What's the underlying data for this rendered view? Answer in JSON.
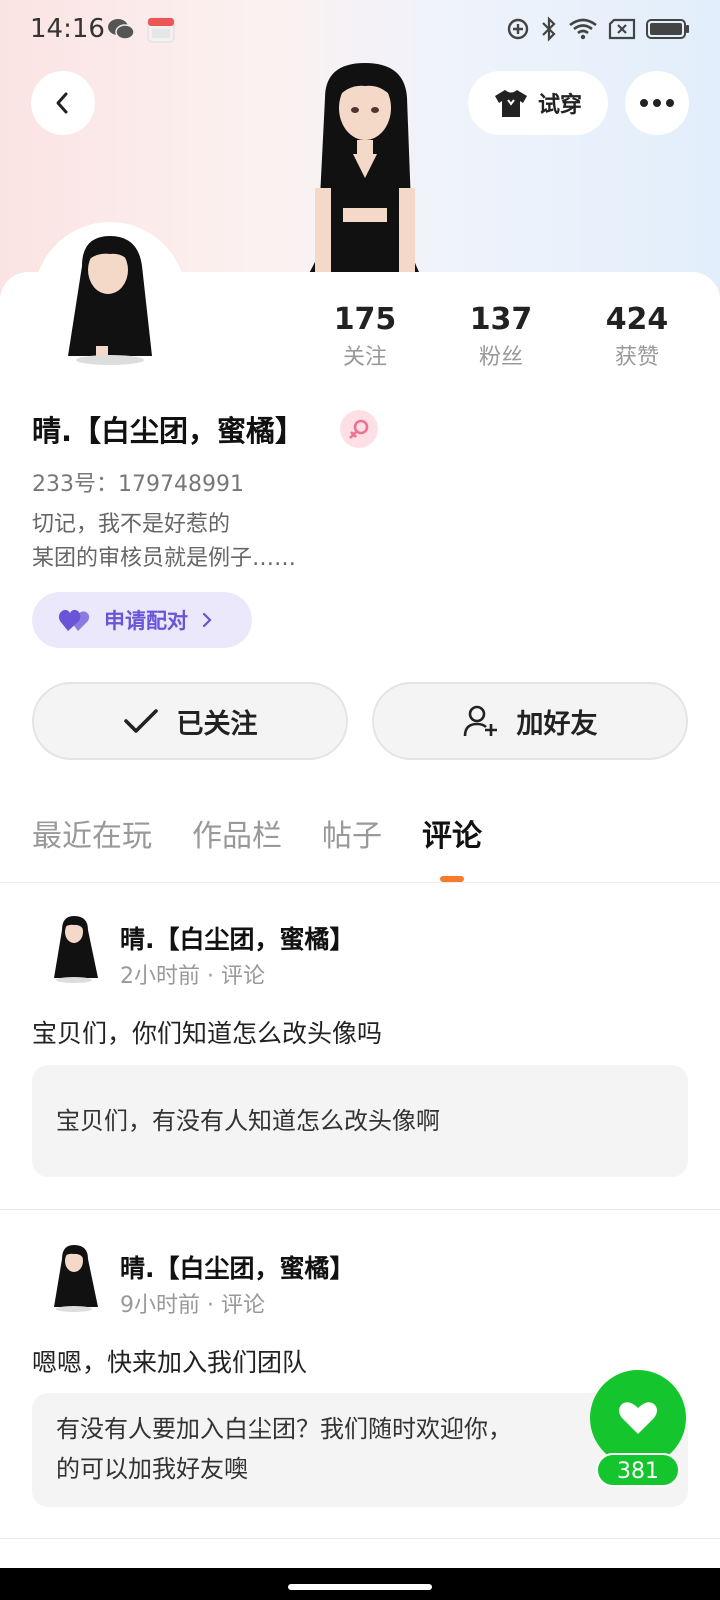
{
  "status_bar": {
    "time": "14:16"
  },
  "header": {
    "tryon_label": "试穿"
  },
  "profile": {
    "stats": [
      {
        "value": "175",
        "label": "关注"
      },
      {
        "value": "137",
        "label": "粉丝"
      },
      {
        "value": "424",
        "label": "获赞"
      }
    ],
    "username": "晴.【白尘团，蜜橘】",
    "uid": "233号：179748991",
    "bio_line1": "切记，我不是好惹的",
    "bio_line2": "某团的审核员就是例子……",
    "pair_label": "申请配对"
  },
  "actions": {
    "follow_label": "已关注",
    "friend_label": "加好友"
  },
  "tabs": [
    {
      "label": "最近在玩"
    },
    {
      "label": "作品栏"
    },
    {
      "label": "帖子"
    },
    {
      "label": "评论"
    }
  ],
  "posts": [
    {
      "author": "晴.【白尘团，蜜橘】",
      "meta": "2小时前 · 评论",
      "text": "宝贝们，你们知道怎么改头像吗",
      "quote": "宝贝们，有没有人知道怎么改头像啊"
    },
    {
      "author": "晴.【白尘团，蜜橘】",
      "meta": "9小时前 · 评论",
      "text": "嗯嗯，快来加入我们团队",
      "quote": "有没有人要加入白尘团？我们随时欢迎你，\n的可以加我好友噢"
    }
  ],
  "like": {
    "count": "381"
  },
  "colors": {
    "accent": "#f77b2b",
    "like_green": "#15c52e",
    "pair_purple": "#6a55d8"
  }
}
